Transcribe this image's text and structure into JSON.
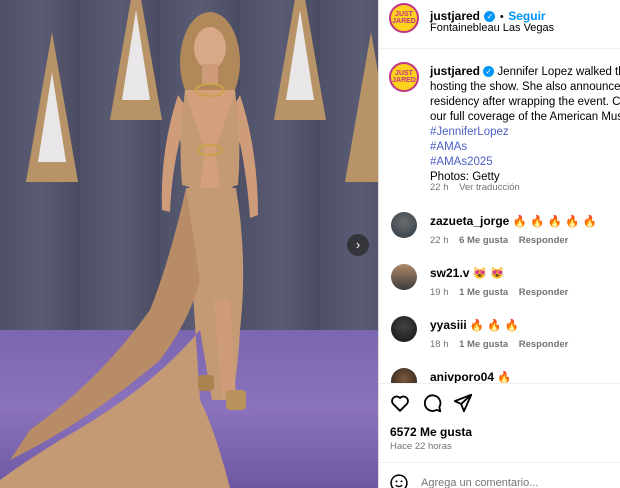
{
  "post": {
    "author": "justjared",
    "follow_label": "Seguir",
    "separator": "•",
    "location": "Fontainebleau Las Vegas",
    "avatar_text": "JUST JARED",
    "caption_lines": [
      "Jennifer Lopez walked the r",
      "hosting the show. She also announced",
      "residency after wrapping the event. Che",
      "our full coverage of the American Music"
    ],
    "hashtags": [
      "#JenniferLopez",
      "#AMAs",
      "#AMAs2025"
    ],
    "photo_credit": "Photos: Getty",
    "caption_time": "22 h",
    "translate_label": "Ver traducción"
  },
  "comments": [
    {
      "user": "zazueta_jorge",
      "text": "🔥 🔥 🔥 🔥 🔥",
      "time": "22 h",
      "likes": "6 Me gusta",
      "reply": "Responder"
    },
    {
      "user": "sw21.v",
      "text": "😻 😻",
      "time": "19 h",
      "likes": "1 Me gusta",
      "reply": "Responder"
    },
    {
      "user": "yyasiii",
      "text": "🔥 🔥 🔥",
      "time": "18 h",
      "likes": "1 Me gusta",
      "reply": "Responder"
    },
    {
      "user": "anivporo04",
      "text": "🔥"
    }
  ],
  "actions": {
    "likes_count": "6572 Me gusta",
    "posted_ago": "Hace 22 horas",
    "comment_placeholder": "Agrega un comentario..."
  },
  "colors": {
    "link_blue": "#0095f6",
    "hashtag": "#4a5dc7",
    "logo_yellow": "#ffd21e",
    "logo_ring": "#c13584",
    "gown": "#c49a74"
  },
  "icons": [
    "heart-icon",
    "comment-icon",
    "share-icon",
    "verified-icon",
    "next-arrow-icon",
    "emoji-icon"
  ]
}
